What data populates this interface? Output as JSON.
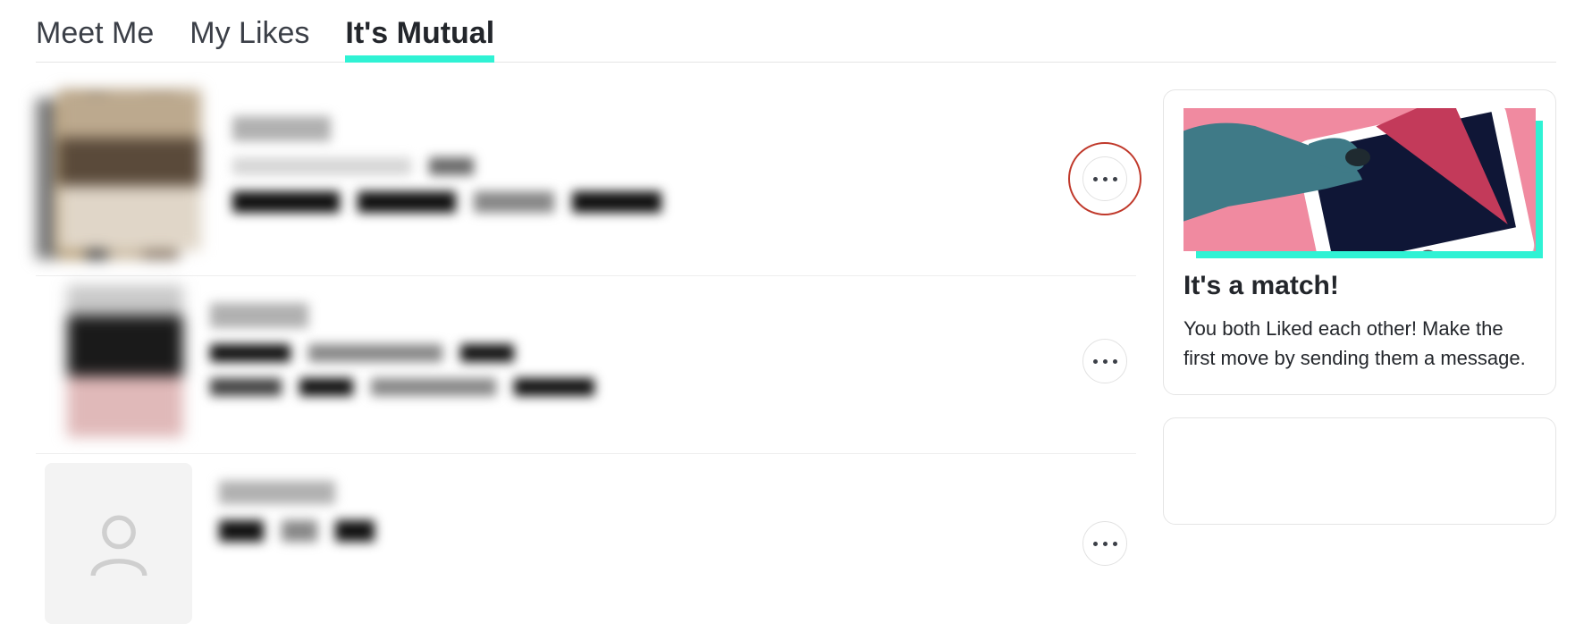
{
  "tabs": {
    "meet_me": "Meet Me",
    "my_likes": "My Likes",
    "its_mutual": "It's Mutual",
    "active": "its_mutual"
  },
  "matches": [
    {
      "avatar_type": "photo-stacked",
      "has_more": true,
      "more_highlighted": true
    },
    {
      "avatar_type": "photo",
      "has_more": true,
      "more_highlighted": false
    },
    {
      "avatar_type": "placeholder",
      "has_more": true,
      "more_highlighted": false
    }
  ],
  "sidebar": {
    "match_card": {
      "title": "It's a match!",
      "body": "You both Liked each other! Make the first move by sending them a message."
    }
  },
  "icons": {
    "more": "more-horizontal-icon",
    "placeholder_avatar": "person-outline-icon"
  }
}
